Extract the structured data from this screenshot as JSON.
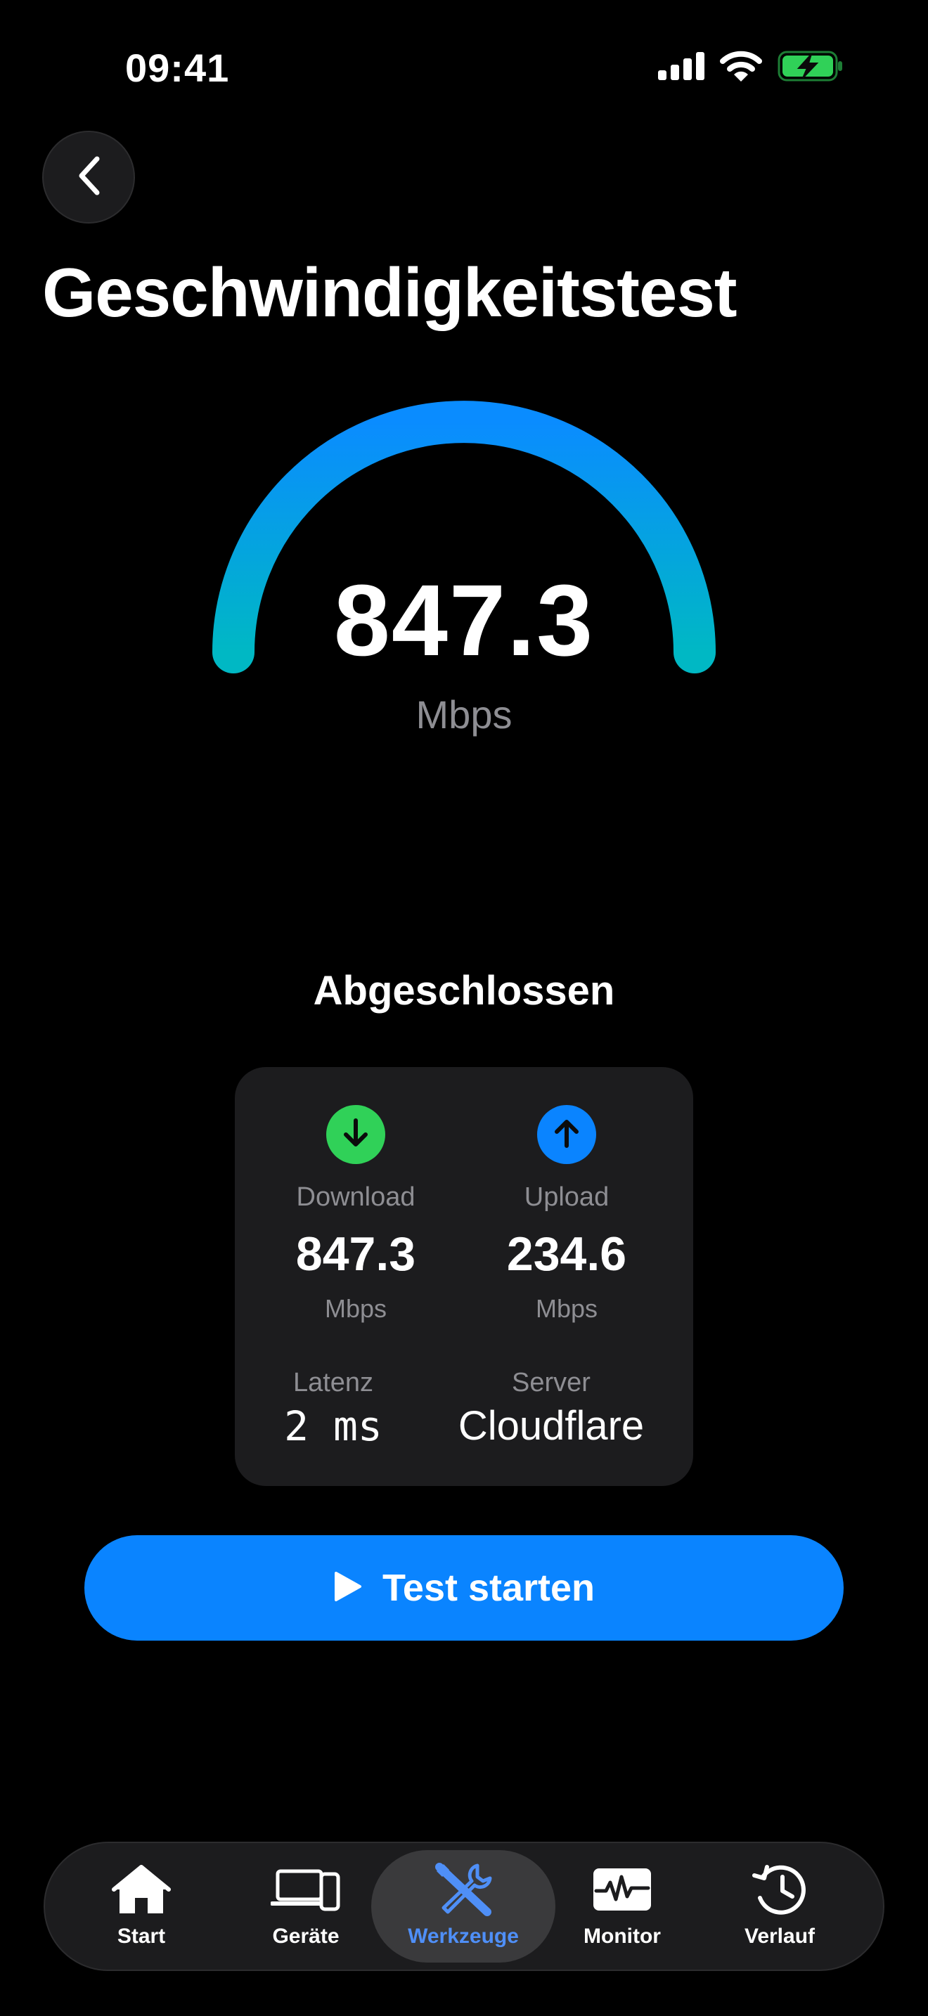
{
  "status_bar": {
    "time": "09:41",
    "icons": [
      "signal-icon",
      "wifi-icon",
      "battery-charging-icon"
    ]
  },
  "header": {
    "back_icon": "chevron-left-icon",
    "title": "Geschwindigkeitstest"
  },
  "gauge": {
    "value": "847.3",
    "unit": "Mbps",
    "fill_fraction": 1.0,
    "gradient": [
      "#0a8cff",
      "#00b8c4"
    ]
  },
  "test_status": "Abgeschlossen",
  "results": {
    "download": {
      "label": "Download",
      "value": "847.3",
      "unit": "Mbps",
      "icon": "arrow-down-icon",
      "color": "#30d158"
    },
    "upload": {
      "label": "Upload",
      "value": "234.6",
      "unit": "Mbps",
      "icon": "arrow-up-icon",
      "color": "#0a84ff"
    },
    "latency": {
      "label": "Latenz",
      "value": "2 ms"
    },
    "server": {
      "label": "Server",
      "value": "Cloudflare"
    }
  },
  "start_button": {
    "label": "Test starten",
    "icon": "play-icon",
    "color": "#0a84ff"
  },
  "tabbar": {
    "active_color": "#4f8ff7",
    "items": [
      {
        "label": "Start",
        "icon": "house-icon"
      },
      {
        "label": "Geräte",
        "icon": "devices-icon"
      },
      {
        "label": "Werkzeuge",
        "icon": "tools-icon"
      },
      {
        "label": "Monitor",
        "icon": "waveform-monitor-icon"
      },
      {
        "label": "Verlauf",
        "icon": "history-icon"
      }
    ]
  }
}
